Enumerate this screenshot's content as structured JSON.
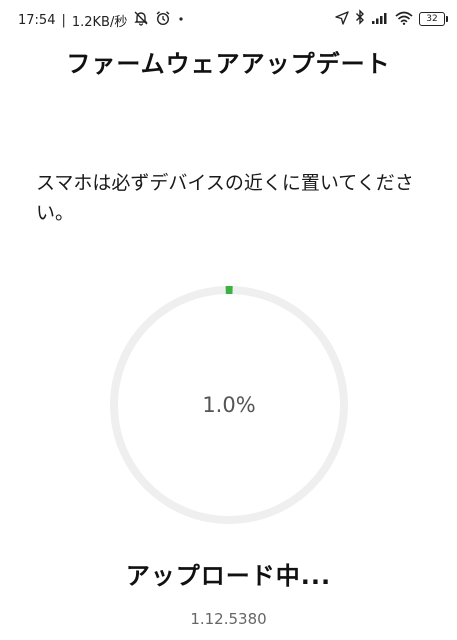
{
  "status_bar": {
    "time": "17:54",
    "separator": "|",
    "network_speed": "1.2KB/秒",
    "battery_level": "32",
    "icons": [
      "mute-icon",
      "alarm-icon",
      "dot-icon",
      "location-icon",
      "bluetooth-icon",
      "signal-icon",
      "wifi-icon",
      "battery-icon"
    ]
  },
  "header": {
    "title": "ファームウェアアップデート"
  },
  "main": {
    "instruction": "スマホは必ずデバイスの近くに置いてください。",
    "progress": {
      "value": 1.0,
      "label": "1.0%",
      "track_color": "#efefef",
      "fill_color": "#3cb043"
    },
    "status": "アップロード中...",
    "version": "1.12.5380"
  }
}
